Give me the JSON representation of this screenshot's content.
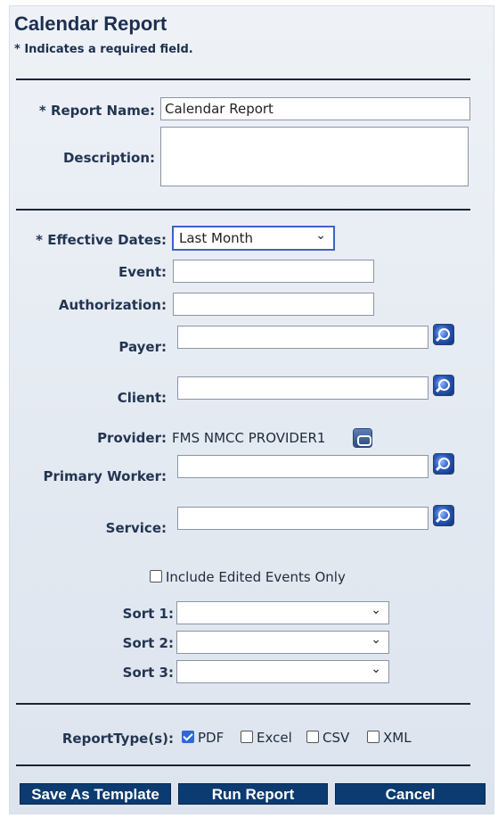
{
  "header": {
    "title": "Calendar Report",
    "required_note": "* Indicates a required field."
  },
  "form": {
    "report_name": {
      "label": "* Report Name:",
      "value": "Calendar Report"
    },
    "description": {
      "label": "Description:",
      "value": ""
    },
    "effective_dates": {
      "label": "* Effective Dates:",
      "selected": "Last Month"
    },
    "event": {
      "label": "Event:",
      "value": ""
    },
    "authorization": {
      "label": "Authorization:",
      "value": ""
    },
    "payer": {
      "label": "Payer:",
      "value": "",
      "icon": "magnifier-lookup-icon"
    },
    "client": {
      "label": "Client:",
      "value": "",
      "icon": "magnifier-lookup-icon"
    },
    "provider": {
      "label": "Provider:",
      "value": "FMS NMCC PROVIDER1",
      "icon": "copy-link-icon"
    },
    "primary_worker": {
      "label": "Primary Worker:",
      "value": "",
      "icon": "magnifier-lookup-icon"
    },
    "service": {
      "label": "Service:",
      "value": "",
      "icon": "magnifier-lookup-icon"
    },
    "include_edited": {
      "label": "Include Edited Events Only",
      "checked": false
    },
    "sort1": {
      "label": "Sort 1:",
      "selected": ""
    },
    "sort2": {
      "label": "Sort 2:",
      "selected": ""
    },
    "sort3": {
      "label": "Sort 3:",
      "selected": ""
    }
  },
  "report_types": {
    "label": "ReportType(s):",
    "options": [
      {
        "label": "PDF",
        "checked": true
      },
      {
        "label": "Excel",
        "checked": false
      },
      {
        "label": "CSV",
        "checked": false
      },
      {
        "label": "XML",
        "checked": false
      }
    ]
  },
  "buttons": {
    "save_template": "Save As Template",
    "run_report": "Run Report",
    "cancel": "Cancel"
  },
  "colors": {
    "button_bg": "#0b3b70",
    "panel_bg": "#e6ebf2",
    "checkbox_checked": "#2f68d8",
    "focus_border": "#3c63c9"
  }
}
